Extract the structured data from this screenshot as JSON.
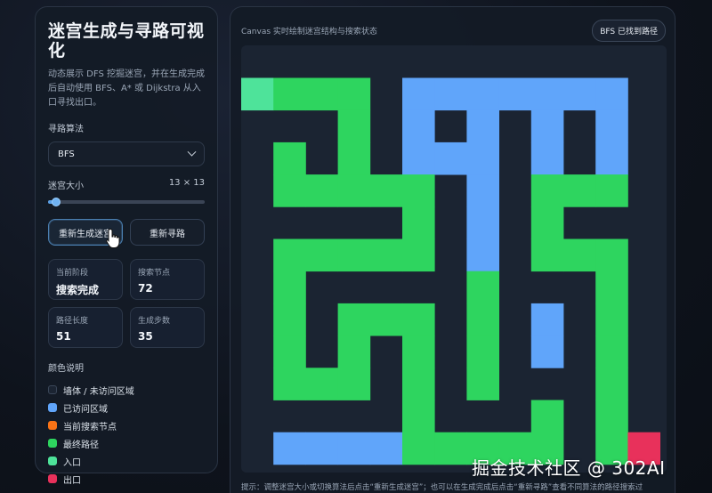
{
  "sidebar": {
    "title": "迷宫生成与寻路可视化",
    "description": "动态展示 DFS 挖掘迷宫，并在生成完成后自动使用 BFS、A* 或 Dijkstra 从入口寻找出口。",
    "algorithm_label": "寻路算法",
    "algorithm_selected": "BFS",
    "size_label": "迷宫大小",
    "size_value": "13 × 13",
    "size_slider_fraction": 0.05,
    "regenerate_button": "重新生成迷宫",
    "research_button": "重新寻路",
    "stats": [
      {
        "label": "当前阶段",
        "value": "搜索完成"
      },
      {
        "label": "搜索节点",
        "value": "72"
      },
      {
        "label": "路径长度",
        "value": "51"
      },
      {
        "label": "生成步数",
        "value": "35"
      }
    ],
    "legend_title": "颜色说明",
    "legend": [
      {
        "label": "墙体 / 未访问区域",
        "color": "#1b2432"
      },
      {
        "label": "已访问区域",
        "color": "#60a5fa"
      },
      {
        "label": "当前搜索节点",
        "color": "#f97316"
      },
      {
        "label": "最终路径",
        "color": "#2ed55f"
      },
      {
        "label": "入口",
        "color": "#4ee39a"
      },
      {
        "label": "出口",
        "color": "#e8315b"
      }
    ]
  },
  "main": {
    "caption": "Canvas 实时绘制迷宫结构与搜索状态",
    "status_badge": "BFS 已找到路径",
    "hint": "提示：调整迷宫大小或切换算法后点击“重新生成迷宫”；也可以在生成完成后点击“重新寻路”查看不同算法的路径搜索过"
  },
  "watermark": "掘金技术社区 @ 302AI",
  "maze": {
    "cols": 13,
    "rows": 13,
    "colors": {
      "wall": "#1b2432",
      "visited": "#60a5fa",
      "path": "#2ed55f",
      "entrance": "#4ee39a",
      "exit": "#e8315b"
    },
    "grid": [
      ".............",
      "ESSS.VVVVVVV.",
      "...S.V.V.V.V.",
      ".S.S.VVV.V.V.",
      ".SSSSS.V.SSS.",
      ".....S.V.S...",
      ".SSSSS.V.SSS.",
      ".S.....S...S.",
      ".S.SSS.S.V.S.",
      ".S.S.S.S.V.S.",
      ".SSS.S.S...S.",
      ".....S...S.S.",
      ".VVVVSSSSS.SX",
      "............."
    ]
  }
}
